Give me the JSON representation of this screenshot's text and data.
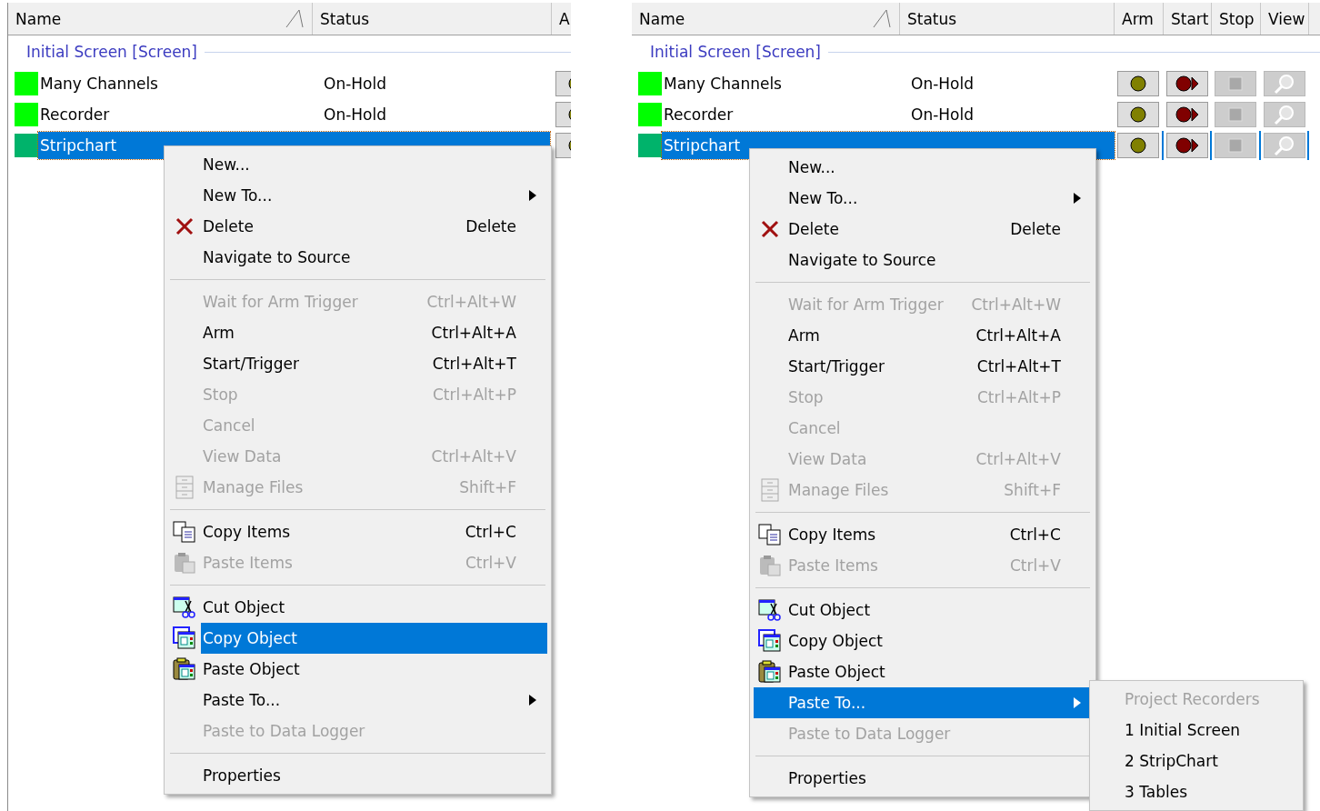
{
  "panels": [
    {
      "columns": [
        "Name",
        "Status",
        "A"
      ],
      "group": "Initial Screen [Screen]",
      "rows": [
        {
          "name": "Many Channels",
          "status": "On-Hold",
          "color": "#00ff00",
          "selected": false,
          "buttons": [
            {
              "kind": "arm",
              "disabled": false
            }
          ]
        },
        {
          "name": "Recorder",
          "status": "On-Hold",
          "color": "#00ff00",
          "selected": false,
          "buttons": [
            {
              "kind": "arm",
              "disabled": false
            }
          ]
        },
        {
          "name": "Stripchart",
          "color": "#00b36b",
          "selected": true,
          "buttons": [
            {
              "kind": "arm",
              "disabled": false
            }
          ]
        }
      ],
      "menu": {
        "items": [
          {
            "kind": "plain",
            "label": "New...",
            "disabled": false,
            "selected": false
          },
          {
            "kind": "submenu",
            "label": "New To...",
            "disabled": false,
            "selected": false
          },
          {
            "kind": "delete",
            "label": "Delete",
            "shortcut": "Delete",
            "disabled": false,
            "selected": false
          },
          {
            "kind": "plain",
            "label": "Navigate to Source",
            "disabled": false,
            "selected": false
          },
          {
            "kind": "separator"
          },
          {
            "kind": "plain",
            "label": "Wait for Arm Trigger",
            "shortcut": "Ctrl+Alt+W",
            "disabled": true,
            "selected": false
          },
          {
            "kind": "plain",
            "label": "Arm",
            "shortcut": "Ctrl+Alt+A",
            "disabled": false,
            "selected": false
          },
          {
            "kind": "plain",
            "label": "Start/Trigger",
            "shortcut": "Ctrl+Alt+T",
            "disabled": false,
            "selected": false
          },
          {
            "kind": "plain",
            "label": "Stop",
            "shortcut": "Ctrl+Alt+P",
            "disabled": true,
            "selected": false
          },
          {
            "kind": "plain",
            "label": "Cancel",
            "disabled": true,
            "selected": false
          },
          {
            "kind": "plain",
            "label": "View Data",
            "shortcut": "Ctrl+Alt+V",
            "disabled": true,
            "selected": false
          },
          {
            "kind": "files",
            "label": "Manage Files",
            "shortcut": "Shift+F",
            "disabled": true,
            "selected": false
          },
          {
            "kind": "separator"
          },
          {
            "kind": "copy-items",
            "label": "Copy Items",
            "shortcut": "Ctrl+C",
            "disabled": false,
            "selected": false
          },
          {
            "kind": "paste-items",
            "label": "Paste Items",
            "shortcut": "Ctrl+V",
            "disabled": true,
            "selected": false
          },
          {
            "kind": "separator"
          },
          {
            "kind": "cut-object",
            "label": "Cut Object",
            "disabled": false,
            "selected": false
          },
          {
            "kind": "copy-object",
            "label": "Copy Object",
            "disabled": false,
            "selected": true
          },
          {
            "kind": "paste-object",
            "label": "Paste Object",
            "disabled": false,
            "selected": false
          },
          {
            "kind": "submenu",
            "label": "Paste To...",
            "disabled": false,
            "selected": false
          },
          {
            "kind": "plain",
            "label": "Paste to Data Logger",
            "disabled": true,
            "selected": false
          },
          {
            "kind": "separator"
          },
          {
            "kind": "plain",
            "label": "Properties",
            "disabled": false,
            "selected": false
          }
        ]
      }
    },
    {
      "columns": [
        "Name",
        "Status",
        "Arm",
        "Start",
        "Stop",
        "View"
      ],
      "group": "Initial Screen [Screen]",
      "rows": [
        {
          "name": "Many Channels",
          "status": "On-Hold",
          "color": "#00ff00",
          "selected": false,
          "buttons": [
            {
              "kind": "arm",
              "disabled": false
            },
            {
              "kind": "start",
              "disabled": false
            },
            {
              "kind": "stop",
              "disabled": true
            },
            {
              "kind": "view",
              "disabled": true
            }
          ]
        },
        {
          "name": "Recorder",
          "status": "On-Hold",
          "color": "#00ff00",
          "selected": false,
          "buttons": [
            {
              "kind": "arm",
              "disabled": false
            },
            {
              "kind": "start",
              "disabled": false
            },
            {
              "kind": "stop",
              "disabled": true
            },
            {
              "kind": "view",
              "disabled": true
            }
          ]
        },
        {
          "name": "Stripchart",
          "color": "#00b36b",
          "selected": true,
          "buttons": [
            {
              "kind": "arm",
              "disabled": false
            },
            {
              "kind": "start",
              "disabled": false
            },
            {
              "kind": "stop",
              "disabled": true
            },
            {
              "kind": "view",
              "disabled": true
            }
          ]
        }
      ],
      "menu": {
        "items": [
          {
            "kind": "plain",
            "label": "New...",
            "disabled": false,
            "selected": false
          },
          {
            "kind": "submenu",
            "label": "New To...",
            "disabled": false,
            "selected": false
          },
          {
            "kind": "delete",
            "label": "Delete",
            "shortcut": "Delete",
            "disabled": false,
            "selected": false
          },
          {
            "kind": "plain",
            "label": "Navigate to Source",
            "disabled": false,
            "selected": false
          },
          {
            "kind": "separator"
          },
          {
            "kind": "plain",
            "label": "Wait for Arm Trigger",
            "shortcut": "Ctrl+Alt+W",
            "disabled": true,
            "selected": false
          },
          {
            "kind": "plain",
            "label": "Arm",
            "shortcut": "Ctrl+Alt+A",
            "disabled": false,
            "selected": false
          },
          {
            "kind": "plain",
            "label": "Start/Trigger",
            "shortcut": "Ctrl+Alt+T",
            "disabled": false,
            "selected": false
          },
          {
            "kind": "plain",
            "label": "Stop",
            "shortcut": "Ctrl+Alt+P",
            "disabled": true,
            "selected": false
          },
          {
            "kind": "plain",
            "label": "Cancel",
            "disabled": true,
            "selected": false
          },
          {
            "kind": "plain",
            "label": "View Data",
            "shortcut": "Ctrl+Alt+V",
            "disabled": true,
            "selected": false
          },
          {
            "kind": "files",
            "label": "Manage Files",
            "shortcut": "Shift+F",
            "disabled": true,
            "selected": false
          },
          {
            "kind": "separator"
          },
          {
            "kind": "copy-items",
            "label": "Copy Items",
            "shortcut": "Ctrl+C",
            "disabled": false,
            "selected": false
          },
          {
            "kind": "paste-items",
            "label": "Paste Items",
            "shortcut": "Ctrl+V",
            "disabled": true,
            "selected": false
          },
          {
            "kind": "separator"
          },
          {
            "kind": "cut-object",
            "label": "Cut Object",
            "disabled": false,
            "selected": false
          },
          {
            "kind": "copy-object",
            "label": "Copy Object",
            "disabled": false,
            "selected": false
          },
          {
            "kind": "paste-object",
            "label": "Paste Object",
            "disabled": false,
            "selected": false
          },
          {
            "kind": "submenu",
            "label": "Paste To...",
            "disabled": false,
            "selected": true
          },
          {
            "kind": "plain",
            "label": "Paste to Data Logger",
            "disabled": true,
            "selected": false
          },
          {
            "kind": "separator"
          },
          {
            "kind": "plain",
            "label": "Properties",
            "disabled": false,
            "selected": false
          }
        ]
      },
      "submenu": {
        "items": [
          {
            "label": "Project Recorders",
            "disabled": true
          },
          {
            "label": "1 Initial Screen",
            "disabled": false
          },
          {
            "label": "2 StripChart",
            "disabled": false
          },
          {
            "label": "3 Tables",
            "disabled": false
          }
        ]
      }
    }
  ]
}
